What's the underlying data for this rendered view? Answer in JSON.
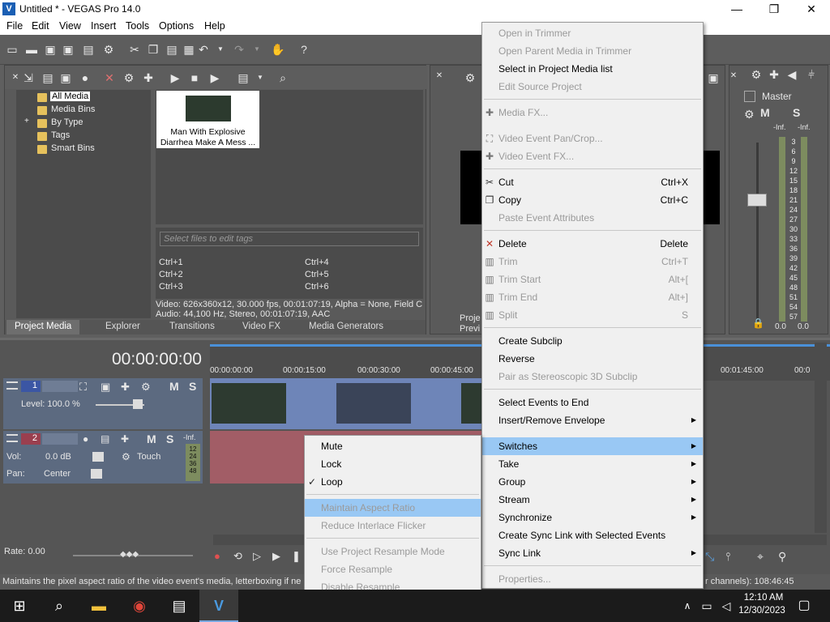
{
  "window": {
    "title": "Untitled * - VEGAS Pro 14.0",
    "logo": "V"
  },
  "window_controls": {
    "minimize": "—",
    "maximize": "❐",
    "close": "✕"
  },
  "menu": [
    "File",
    "Edit",
    "View",
    "Insert",
    "Tools",
    "Options",
    "Help"
  ],
  "project_media": {
    "tree": [
      "All Media",
      "Media Bins",
      "By Type",
      "Tags",
      "Smart Bins"
    ],
    "expander": "+",
    "media_item": {
      "line1": "Man With Explosive",
      "line2": "Diarrhea Make A Mess ..."
    },
    "tag_placeholder": "Select files to edit tags",
    "shortcuts": [
      "Ctrl+1",
      "Ctrl+4",
      "Ctrl+2",
      "Ctrl+5",
      "Ctrl+3",
      "Ctrl+6"
    ],
    "info_video": "Video: 626x360x12, 30.000 fps, 00:01:07:19, Alpha = None, Field C",
    "info_audio": "Audio: 44,100 Hz, Stereo, 00:01:07:19, AAC",
    "tabs": [
      "Project Media",
      "Explorer",
      "Transitions",
      "Video FX",
      "Media Generators"
    ]
  },
  "preview": {
    "label1": "Proje",
    "label2": "Previ"
  },
  "mixer": {
    "title": "Master",
    "inf_left": "-Inf.",
    "inf_right": "-Inf.",
    "scale": [
      "3",
      "6",
      "9",
      "12",
      "15",
      "18",
      "21",
      "24",
      "27",
      "30",
      "33",
      "36",
      "39",
      "42",
      "45",
      "48",
      "51",
      "54",
      "57"
    ],
    "val_left": "0.0",
    "val_right": "0.0",
    "m_label": "M",
    "s_label": "S"
  },
  "timeline": {
    "time": "00:00:00:00",
    "ruler": [
      "00:00:00:00",
      "00:00:15:00",
      "00:00:30:00",
      "00:00:45:00",
      "00:01:45:00",
      "00:0"
    ],
    "track1": {
      "num": "1",
      "level": "Level: 100.0 %",
      "m": "M",
      "s": "S"
    },
    "track2": {
      "num": "2",
      "vol_label": "Vol:",
      "vol_value": "0.0 dB",
      "pan_label": "Pan:",
      "pan_value": "Center",
      "mode": "Touch",
      "inf": "-Inf.",
      "meter": [
        "12",
        "24",
        "36",
        "48"
      ],
      "m": "M",
      "s": "S"
    },
    "rate": "Rate: 0.00"
  },
  "status": {
    "text": "Maintains the pixel aspect ratio of the video event's media, letterboxing if ne",
    "right": "r channels): 108:46:45"
  },
  "context_menu": {
    "items": [
      {
        "label": "Open in Trimmer",
        "enabled": false
      },
      {
        "label": "Open Parent Media in Trimmer",
        "enabled": false
      },
      {
        "label": "Select in Project Media list",
        "enabled": true
      },
      {
        "label": "Edit Source Project",
        "enabled": false
      },
      {
        "label": "Media FX...",
        "enabled": false
      },
      {
        "label": "Video Event Pan/Crop...",
        "enabled": false
      },
      {
        "label": "Video Event FX...",
        "enabled": false
      },
      {
        "label": "Cut",
        "shortcut": "Ctrl+X",
        "enabled": true
      },
      {
        "label": "Copy",
        "shortcut": "Ctrl+C",
        "enabled": true
      },
      {
        "label": "Paste Event Attributes",
        "enabled": false
      },
      {
        "label": "Delete",
        "shortcut": "Delete",
        "enabled": true
      },
      {
        "label": "Trim",
        "shortcut": "Ctrl+T",
        "enabled": false
      },
      {
        "label": "Trim Start",
        "shortcut": "Alt+[",
        "enabled": false
      },
      {
        "label": "Trim End",
        "shortcut": "Alt+]",
        "enabled": false
      },
      {
        "label": "Split",
        "shortcut": "S",
        "enabled": false
      },
      {
        "label": "Create Subclip",
        "enabled": true
      },
      {
        "label": "Reverse",
        "enabled": true
      },
      {
        "label": "Pair as Stereoscopic 3D Subclip",
        "enabled": false
      },
      {
        "label": "Select Events to End",
        "enabled": true
      },
      {
        "label": "Insert/Remove Envelope",
        "enabled": true
      },
      {
        "label": "Switches",
        "enabled": true
      },
      {
        "label": "Take",
        "enabled": true
      },
      {
        "label": "Group",
        "enabled": true
      },
      {
        "label": "Stream",
        "enabled": true
      },
      {
        "label": "Synchronize",
        "enabled": true
      },
      {
        "label": "Create Sync Link with Selected Events",
        "enabled": true
      },
      {
        "label": "Sync Link",
        "enabled": true
      },
      {
        "label": "Properties...",
        "enabled": false
      }
    ],
    "arrow": "▶"
  },
  "switches_submenu": {
    "items": [
      {
        "label": "Mute",
        "enabled": true
      },
      {
        "label": "Lock",
        "enabled": true
      },
      {
        "label": "Loop",
        "enabled": true,
        "checked": true
      },
      {
        "label": "Maintain Aspect Ratio",
        "enabled": false
      },
      {
        "label": "Reduce Interlace Flicker",
        "enabled": false
      },
      {
        "label": "Use Project Resample Mode",
        "enabled": false
      },
      {
        "label": "Force Resample",
        "enabled": false
      },
      {
        "label": "Disable Resample",
        "enabled": false
      }
    ],
    "check": "✓"
  },
  "taskbar": {
    "time": "12:10 AM",
    "date": "12/30/2023"
  },
  "colors": {
    "accent": "#99c8f4",
    "track_header": "#5c6a80",
    "audio_event": "#a25d66"
  }
}
